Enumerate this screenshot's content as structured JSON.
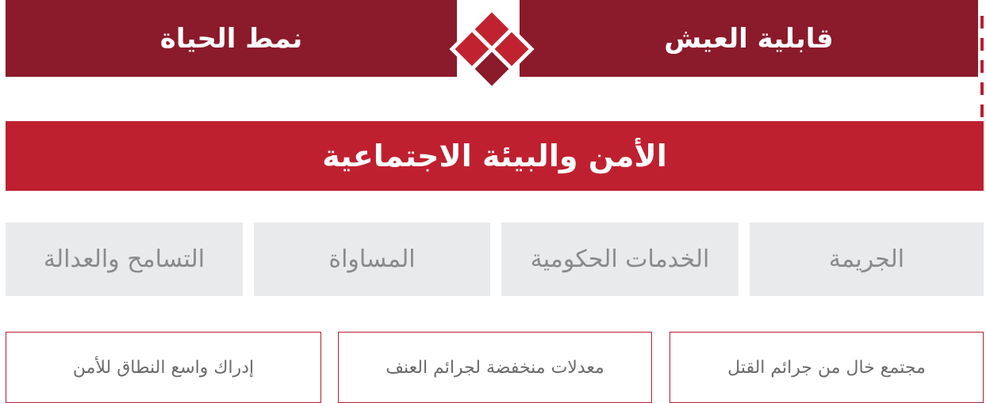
{
  "header": {
    "left_title": "نمط الحياة",
    "right_title": "قابلية العيش"
  },
  "section": {
    "title": "الأمن والبيئة الاجتماعية"
  },
  "tabs": [
    {
      "label": "الجريمة"
    },
    {
      "label": "الخدمات الحكومية"
    },
    {
      "label": "المساواة"
    },
    {
      "label": "التسامح والعدالة"
    }
  ],
  "indicators": [
    {
      "label": "مجتمع خال من جرائم القتل"
    },
    {
      "label": "معدلات منخفضة لجرائم العنف"
    },
    {
      "label": "إدراك واسع النطاق للأمن"
    }
  ],
  "colors": {
    "dark_red": "#8b1a2a",
    "red": "#bf202f",
    "tab_bg": "#e9eaec",
    "tab_text": "#8a8a8a"
  }
}
